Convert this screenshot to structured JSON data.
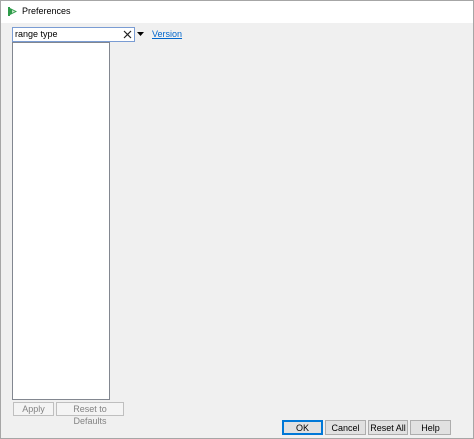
{
  "window": {
    "title": "Preferences",
    "icon": "jmp-arrow-icon",
    "accent_color": "#2e9c4a"
  },
  "search": {
    "value": "range type",
    "clear_icon": "close-icon",
    "dropdown_icon": "triangle-down-icon"
  },
  "links": {
    "version": "Version"
  },
  "category_list": {
    "items": []
  },
  "buttons": {
    "apply": "Apply",
    "reset_to_defaults": "Reset to Defaults",
    "ok": "OK",
    "cancel": "Cancel",
    "reset_all": "Reset All",
    "help": "Help"
  }
}
